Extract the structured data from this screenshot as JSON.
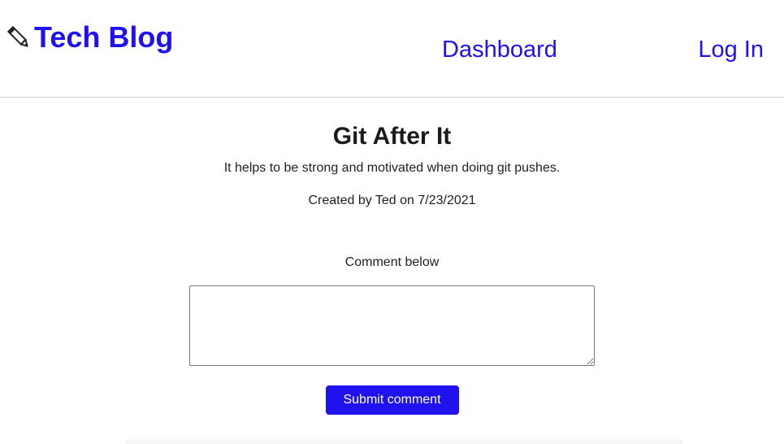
{
  "header": {
    "logo_text": "Tech Blog",
    "logo_icon": "pencil-icon",
    "nav": {
      "dashboard_label": "Dashboard",
      "login_label": "Log In"
    }
  },
  "post": {
    "title": "Git After It",
    "body": "It helps to be strong and motivated when doing git pushes.",
    "meta": "Created by Ted on 7/23/2021"
  },
  "comment": {
    "label": "Comment below",
    "value": "",
    "submit_label": "Submit comment"
  },
  "colors": {
    "accent": "#1f12ee",
    "text": "#1f1f1f",
    "divider": "#cfcfcf"
  }
}
